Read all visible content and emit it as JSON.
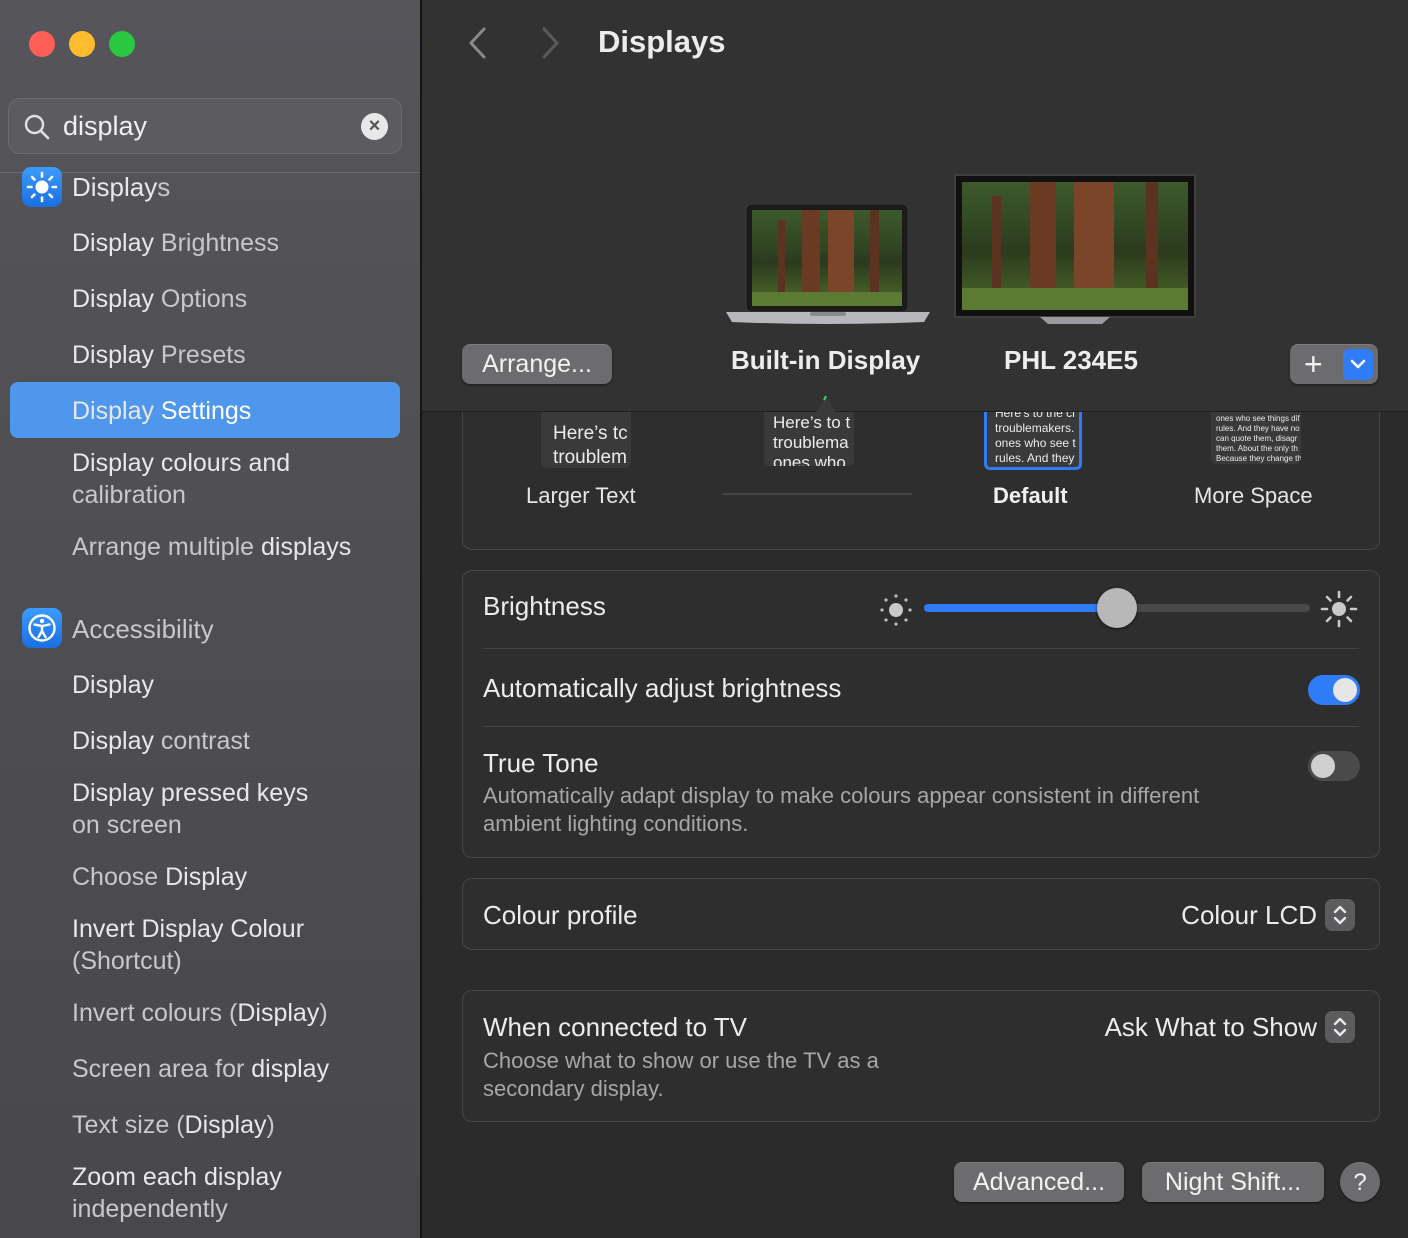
{
  "window": {
    "title": "Displays"
  },
  "sidebar": {
    "search": {
      "value": "display"
    },
    "items": [
      {
        "pre": "",
        "match": "Display",
        "post": "s"
      },
      {
        "pre": "",
        "match": "Display",
        "post": " Brightness"
      },
      {
        "pre": "",
        "match": "Display",
        "post": " Options"
      },
      {
        "pre": "",
        "match": "Display",
        "post": " Presets"
      },
      {
        "pre": "",
        "match": "Display",
        "post": " Settings"
      },
      {
        "line1": "Display colours and",
        "line2": "calibration"
      },
      {
        "pre": "Arrange multiple ",
        "match": "displays",
        "post": ""
      },
      {
        "label": "Accessibility"
      },
      {
        "pre": "",
        "match": "Display",
        "post": ""
      },
      {
        "pre": "",
        "match": "Display",
        "post": " contrast"
      },
      {
        "line1": "Display pressed keys",
        "line2": "on screen"
      },
      {
        "pre": "Choose ",
        "match": "Display",
        "post": ""
      },
      {
        "line1": "Invert Display Colour",
        "line2": "(Shortcut)"
      },
      {
        "pre": "Invert colours (",
        "match": "Display",
        "post": ")"
      },
      {
        "pre": "Screen area for ",
        "match": "display",
        "post": ""
      },
      {
        "pre": "Text size (",
        "match": "Display",
        "post": ")"
      },
      {
        "line1": "Zoom each display",
        "line2": "independently"
      }
    ]
  },
  "displays": {
    "arrange_button": "Arrange...",
    "builtin_label": "Built-in Display",
    "external_label": "PHL 234E5",
    "add_button": "+"
  },
  "resolution": {
    "options": [
      {
        "label": "Larger Text",
        "preview_line1": "Here’s tc",
        "preview_line2": "troublem"
      },
      {
        "label": "",
        "preview_line1": "Here’s to t",
        "preview_line2": "troublema",
        "preview_line3": "ones who"
      },
      {
        "label": "Default",
        "preview_line1": "Here’s to the cr",
        "preview_line2": "troublemakers.",
        "preview_line3": "ones who see t",
        "preview_line4": "rules. And they"
      },
      {
        "label": "More Space",
        "preview_line1": "ones who see things dif",
        "preview_line2": "rules. And they have no",
        "preview_line3": "can quote them, disagr",
        "preview_line4": "them. About the only th",
        "preview_line5": "Because they change th"
      }
    ],
    "selected": "Default"
  },
  "brightness": {
    "label": "Brightness",
    "level": 0.5,
    "auto_label": "Automatically adjust brightness",
    "auto_on": true,
    "true_tone_label": "True Tone",
    "true_tone_desc_line1": "Automatically adapt display to make colours appear consistent in different",
    "true_tone_desc_line2": "ambient lighting conditions.",
    "true_tone_on": false
  },
  "colour_profile": {
    "label": "Colour profile",
    "value": "Colour LCD"
  },
  "tv": {
    "label": "When connected to TV",
    "value": "Ask What to Show",
    "desc_line1": "Choose what to show or use the TV as a",
    "desc_line2": "secondary display."
  },
  "footer": {
    "advanced": "Advanced...",
    "night_shift": "Night Shift...",
    "help": "?"
  },
  "colors": {
    "accent": "#2f7cf6",
    "selection": "#4f97ec"
  }
}
